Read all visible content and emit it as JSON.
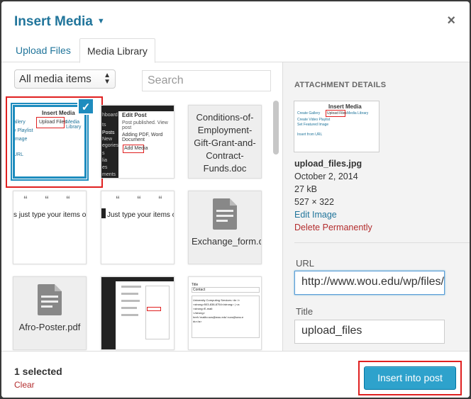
{
  "modal": {
    "title": "Insert Media",
    "close_glyph": "×",
    "tabs": [
      {
        "label": "Upload Files",
        "active": false
      },
      {
        "label": "Media Library",
        "active": true
      }
    ]
  },
  "toolbar": {
    "filter_value": "All media items",
    "search_placeholder": "Search"
  },
  "grid": {
    "items": [
      {
        "kind": "image",
        "selected": true,
        "preview_title": "Insert Media",
        "preview_tab1": "Upload Files",
        "preview_tab2": "Media Library",
        "preview_side": [
          "allery",
          "y Playlist",
          "Image",
          "URL"
        ]
      },
      {
        "kind": "image",
        "preview_title": "Edit Post",
        "preview_sub": "Adding PDF, Word Document",
        "preview_btn": "Add Media",
        "preview_note": "Post published. View post",
        "preview_menu": [
          "hboard",
          "ts",
          "Posts",
          "New",
          "egories",
          "s",
          "lia",
          "es",
          "ments"
        ]
      },
      {
        "kind": "document",
        "name": "Conditions-of-Employment-Gift-Grant-and-Contract-Funds.doc"
      },
      {
        "kind": "image",
        "preview_text": "s just type your items out and"
      },
      {
        "kind": "image",
        "preview_text": "Just type your items out and h"
      },
      {
        "kind": "document",
        "name": "Exchange_form.doc"
      },
      {
        "kind": "document",
        "name": "Afro-Poster.pdf"
      },
      {
        "kind": "image"
      },
      {
        "kind": "image",
        "preview_lines": [
          "Title",
          "Contact",
          "University Computing Services <br />",
          "<strong>503-838-8754</strong> | <a",
          "<strong>E-mail:",
          "</strong>",
          "href='mailto:ucs@wou.edu'>ucs@wou.e",
          "du</a>"
        ]
      }
    ]
  },
  "sidebar": {
    "heading": "ATTACHMENT DETAILS",
    "thumb": {
      "title": "Insert Media",
      "tab1": "Upload Files",
      "tab2": "Media Library",
      "side": [
        "Create Gallery",
        "Create Video Playlist",
        "Set Featured Image",
        "Insert from URL"
      ]
    },
    "filename": "upload_files.jpg",
    "date": "October 2, 2014",
    "size": "27 kB",
    "dimensions": "527 × 322",
    "edit_label": "Edit Image",
    "delete_label": "Delete Permanently",
    "url_label": "URL",
    "url_value": "http://www.wou.edu/wp/files/upload_files.jpg",
    "title_label": "Title",
    "title_value": "upload_files"
  },
  "footer": {
    "selected_count": "1 selected",
    "clear_label": "Clear",
    "insert_label": "Insert into post"
  },
  "colors": {
    "accent": "#21759b",
    "button": "#2ea2cc",
    "danger": "#b32d2e",
    "highlight": "#e02020"
  }
}
